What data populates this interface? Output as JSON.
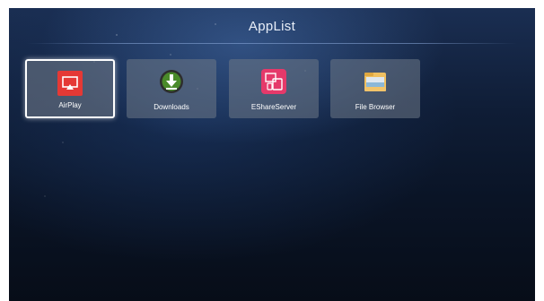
{
  "header": {
    "title": "AppList"
  },
  "apps": [
    {
      "label": "AirPlay",
      "icon": "airplay-icon",
      "selected": true,
      "color": "#e53935"
    },
    {
      "label": "Downloads",
      "icon": "download-icon",
      "selected": false,
      "color": "#4a8a2a"
    },
    {
      "label": "EShareServer",
      "icon": "eshare-icon",
      "selected": false,
      "color": "#e5396a"
    },
    {
      "label": "File Browser",
      "icon": "folder-icon",
      "selected": false,
      "color": "#f0c060"
    }
  ]
}
